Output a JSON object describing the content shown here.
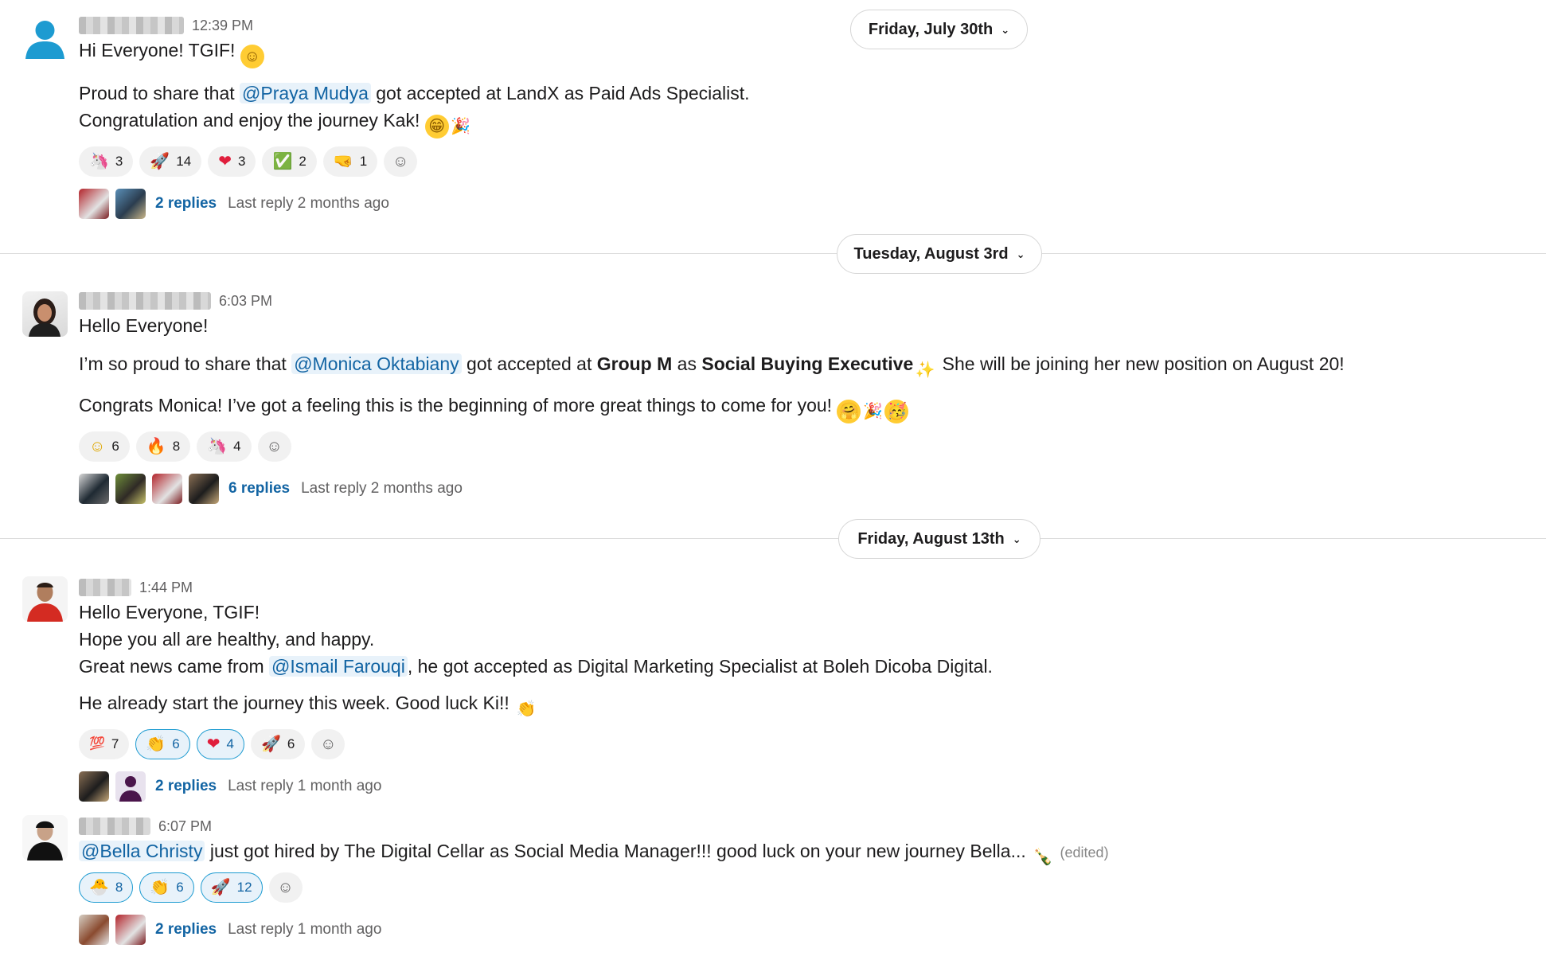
{
  "dates": [
    {
      "label": "Friday, July 30th"
    },
    {
      "label": "Tuesday, August 3rd"
    },
    {
      "label": "Friday, August 13th"
    }
  ],
  "messages": [
    {
      "time": "12:39 PM",
      "line1": "Hi Everyone! TGIF!",
      "line2_a": "Proud to share that ",
      "line2_mention": "@Praya Mudya",
      "line2_b": " got accepted at LandX as Paid Ads Specialist.",
      "line3": "Congratulation and enjoy the journey Kak!",
      "reactions": [
        {
          "icon": "rainbow-unicorn-icon",
          "glyph": "🦄",
          "count": "3"
        },
        {
          "icon": "rocket-icon",
          "glyph": "🚀",
          "count": "14"
        },
        {
          "icon": "heart-icon",
          "glyph": "❤",
          "count": "3"
        },
        {
          "icon": "check-mark-icon",
          "glyph": "✅",
          "count": "2"
        },
        {
          "icon": "fist-bump-icon",
          "glyph": "🤜",
          "count": "1"
        }
      ],
      "replies": "2 replies",
      "last_reply": "Last reply 2 months ago"
    },
    {
      "time": "6:03 PM",
      "line1": "Hello Everyone!",
      "line2_a": "I’m so proud to share that ",
      "line2_mention": "@Monica Oktabiany",
      "line2_b": " got accepted at ",
      "line2_bold1": "Group M",
      "line2_c": " as ",
      "line2_bold2": "Social Buying Executive",
      "line2_d": " She will be joining her new position on August 20!",
      "line3": "Congrats Monica! I’ve got a feeling this is the beginning of more great things to come for you!",
      "reactions": [
        {
          "icon": "smile-icon",
          "glyph": "☺",
          "count": "6"
        },
        {
          "icon": "fire-icon",
          "glyph": "🔥",
          "count": "8"
        },
        {
          "icon": "rainbow-unicorn-icon",
          "glyph": "🦄",
          "count": "4"
        }
      ],
      "replies": "6 replies",
      "last_reply": "Last reply 2 months ago"
    },
    {
      "time": "1:44 PM",
      "line1": "Hello Everyone, TGIF!",
      "line2": "Hope you all are healthy, and happy.",
      "line3_a": "Great news came from ",
      "line3_mention": "@Ismail Farouqi",
      "line3_b": ", he got accepted as Digital Marketing Specialist at Boleh Dicoba Digital.",
      "line4": "He already start the journey this week. Good luck Ki!!",
      "reactions": [
        {
          "icon": "hundred-icon",
          "glyph": "💯",
          "count": "7",
          "mine": false
        },
        {
          "icon": "clapping-hands-icon",
          "glyph": "👏",
          "count": "6",
          "mine": true
        },
        {
          "icon": "heart-icon",
          "glyph": "❤",
          "count": "4",
          "mine": true
        },
        {
          "icon": "rocket-icon",
          "glyph": "🚀",
          "count": "6",
          "mine": false
        }
      ],
      "replies": "2 replies",
      "last_reply": "Last reply 1 month ago"
    },
    {
      "time": "6:07 PM",
      "line1_mention": "@Bella Christy",
      "line1_b": " just got hired by The Digital Cellar as Social Media Manager!!! good luck on your new journey Bella...",
      "edited": "(edited)",
      "reactions": [
        {
          "icon": "hatching-chick-icon",
          "glyph": "🐣",
          "count": "8",
          "mine": true
        },
        {
          "icon": "clapping-hands-icon",
          "glyph": "👏",
          "count": "6",
          "mine": true
        },
        {
          "icon": "rocket-icon",
          "glyph": "🚀",
          "count": "12",
          "mine": true
        }
      ],
      "replies": "2 replies",
      "last_reply": "Last reply 1 month ago"
    }
  ],
  "colors": {
    "link": "#1264a3",
    "mention_bg": "#e8f2fa",
    "reaction_mine_border": "#1d9bd1"
  }
}
